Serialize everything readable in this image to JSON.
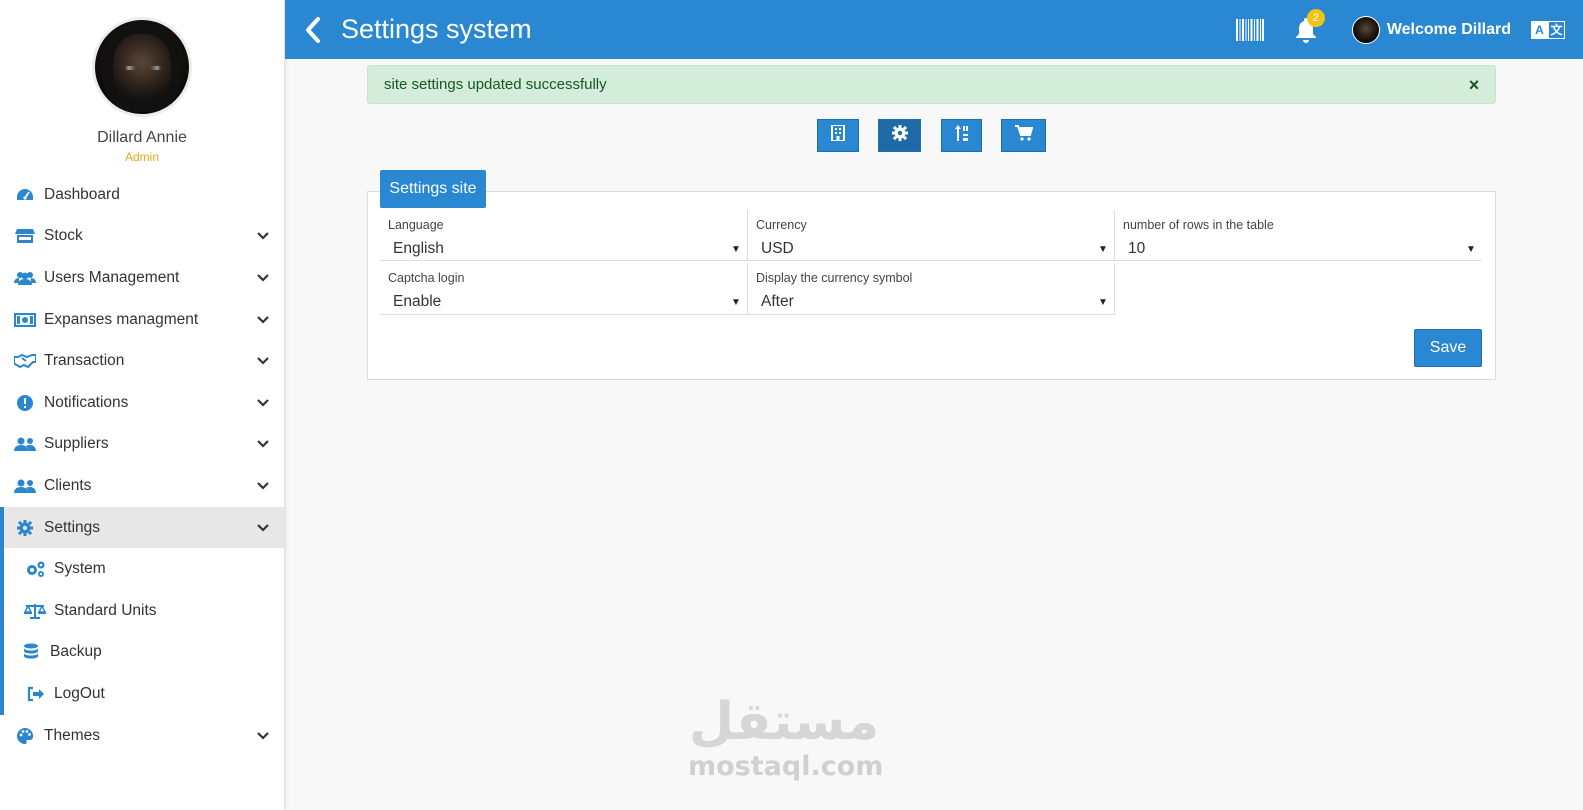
{
  "sidebar": {
    "profile": {
      "name": "Dillard Annie",
      "role": "Admin"
    },
    "items": [
      {
        "label": "Dashboard",
        "icon": "dashboard-icon"
      },
      {
        "label": "Stock",
        "icon": "store-icon"
      },
      {
        "label": "Users Management",
        "icon": "users-icon"
      },
      {
        "label": "Expanses managment",
        "icon": "money-bill-icon"
      },
      {
        "label": "Transaction",
        "icon": "handshake-icon"
      },
      {
        "label": "Notifications",
        "icon": "exclamation-circle-icon"
      },
      {
        "label": "Suppliers",
        "icon": "users-icon"
      },
      {
        "label": "Clients",
        "icon": "users-icon"
      },
      {
        "label": "Settings",
        "icon": "cog-icon"
      },
      {
        "label": "Themes",
        "icon": "palette-icon"
      }
    ],
    "settings_sub": [
      {
        "label": "System",
        "icon": "cogs-icon"
      },
      {
        "label": "Standard Units",
        "icon": "balance-scale-icon"
      },
      {
        "label": "Backup",
        "icon": "database-icon"
      },
      {
        "label": "LogOut",
        "icon": "sign-out-icon"
      }
    ]
  },
  "header": {
    "title": "Settings system",
    "notification_count": "2",
    "welcome": "Welcome Dillard",
    "lang_a": "A",
    "lang_b": "文"
  },
  "alert": {
    "message": "site settings updated successfully",
    "close": "×"
  },
  "toolbar": [
    "building-icon",
    "cog-icon",
    "sort-icon",
    "cart-icon"
  ],
  "tab": {
    "label": "Settings site"
  },
  "form": {
    "language": {
      "label": "Language",
      "value": "English"
    },
    "currency": {
      "label": "Currency",
      "value": "USD"
    },
    "rows": {
      "label": "number of rows in the table",
      "value": "10"
    },
    "captcha": {
      "label": "Captcha login",
      "value": "Enable"
    },
    "currency_symbol": {
      "label": "Display the currency symbol",
      "value": "After"
    },
    "save": "Save"
  },
  "watermark": {
    "arabic": "مستقل",
    "latin": "mostaql.com"
  },
  "colors": {
    "primary": "#2a87d2",
    "success_bg": "#d4edda",
    "badge": "#f3c316",
    "role": "#e6a817"
  }
}
